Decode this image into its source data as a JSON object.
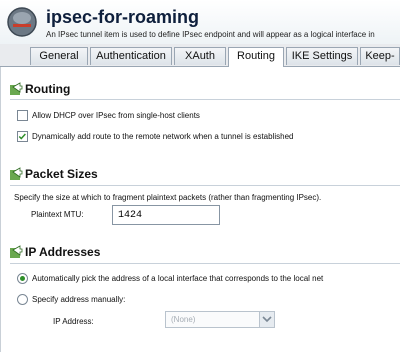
{
  "header": {
    "title": "ipsec-for-roaming",
    "subtitle": "An IPsec tunnel item is used to define IPsec endpoint and will appear as a logical interface in"
  },
  "tabs": [
    {
      "label": "General",
      "active": false
    },
    {
      "label": "Authentication",
      "active": false
    },
    {
      "label": "XAuth",
      "active": false
    },
    {
      "label": "Routing",
      "active": true
    },
    {
      "label": "IKE Settings",
      "active": false
    },
    {
      "label": "Keep-",
      "active": false
    }
  ],
  "routing": {
    "heading": "Routing",
    "icon": "arrow-right-icon",
    "allow_dhcp": {
      "label": "Allow DHCP over IPsec from single-host clients",
      "checked": false
    },
    "dynamic_route": {
      "label": "Dynamically add route to the remote network when a tunnel is established",
      "checked": true
    }
  },
  "packet_sizes": {
    "heading": "Packet Sizes",
    "description": "Specify the size at which to fragment plaintext packets (rather than fragmenting IPsec).",
    "mtu_label": "Plaintext MTU:",
    "mtu_value": "1424"
  },
  "ip_addresses": {
    "heading": "IP Addresses",
    "auto_pick": {
      "label": "Automatically pick the address of a local interface that corresponds to the local net",
      "selected": true
    },
    "manual": {
      "label": "Specify address manually:",
      "selected": false
    },
    "ip_label": "IP Address:",
    "ip_select_value": "(None)"
  },
  "colors": {
    "title": "#0e1f3c",
    "checkmark": "#2f8f2a",
    "divider": "#c8d1da"
  }
}
